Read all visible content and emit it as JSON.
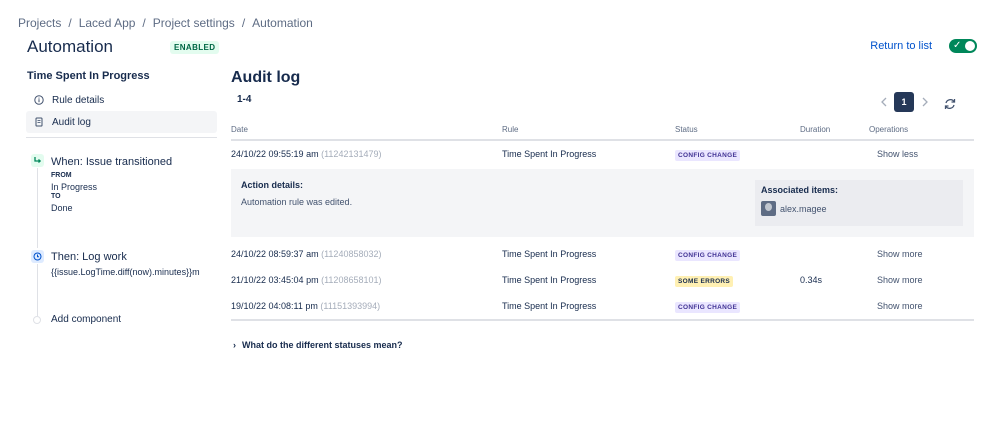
{
  "breadcrumb": [
    "Projects",
    "Laced App",
    "Project settings",
    "Automation"
  ],
  "header": {
    "title": "Automation",
    "status_badge": "ENABLED",
    "return_link": "Return to list",
    "toggle_on": true
  },
  "sidebar": {
    "rule_name": "Time Spent In Progress",
    "items": [
      {
        "label": "Rule details",
        "icon": "info-icon"
      },
      {
        "label": "Audit log",
        "icon": "document-icon",
        "active": true
      }
    ]
  },
  "components": {
    "trigger": {
      "title": "When: Issue transitioned",
      "from_label": "FROM",
      "from_value": "In Progress",
      "to_label": "TO",
      "to_value": "Done"
    },
    "action": {
      "title": "Then: Log work",
      "value": "{{issue.LogTime.diff(now).minutes}}m"
    },
    "add_label": "Add component"
  },
  "audit": {
    "title": "Audit log",
    "range": "1-4",
    "pager": {
      "current": "1"
    },
    "columns": [
      "Date",
      "Rule",
      "Status",
      "Duration",
      "Operations"
    ],
    "rows": [
      {
        "date": "24/10/22 09:55:19 am",
        "exec": "(11242131479)",
        "rule": "Time Spent In Progress",
        "status": "CONFIG CHANGE",
        "status_kind": "config",
        "duration": "",
        "op": "Show less"
      },
      {
        "date": "24/10/22 08:59:37 am",
        "exec": "(11240858032)",
        "rule": "Time Spent In Progress",
        "status": "CONFIG CHANGE",
        "status_kind": "config",
        "duration": "",
        "op": "Show more"
      },
      {
        "date": "21/10/22 03:45:04 pm",
        "exec": "(11208658101)",
        "rule": "Time Spent In Progress",
        "status": "SOME ERRORS",
        "status_kind": "errors",
        "duration": "0.34s",
        "op": "Show more"
      },
      {
        "date": "19/10/22 04:08:11 pm",
        "exec": "(11151393994)",
        "rule": "Time Spent In Progress",
        "status": "CONFIG CHANGE",
        "status_kind": "config",
        "duration": "",
        "op": "Show more"
      }
    ],
    "details": {
      "title": "Action details:",
      "text": "Automation rule was edited.",
      "associated_title": "Associated items:",
      "associated_user": "alex.magee"
    },
    "statuses_question": "What do the different statuses mean?"
  }
}
